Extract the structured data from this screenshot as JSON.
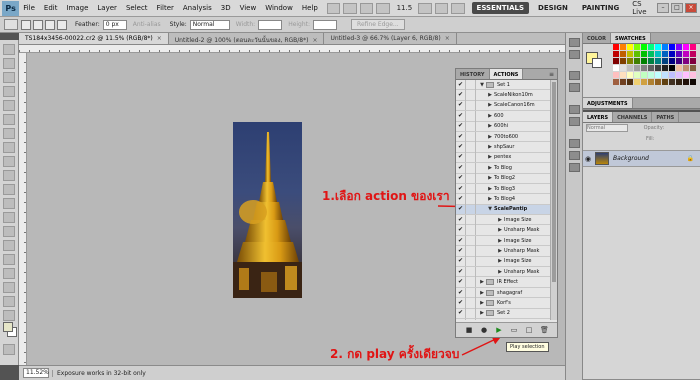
{
  "app": {
    "logo": "Ps",
    "menu": [
      "File",
      "Edit",
      "Image",
      "Layer",
      "Select",
      "Filter",
      "Analysis",
      "3D",
      "View",
      "Window",
      "Help"
    ],
    "zoom": "11.5",
    "workspaces": [
      "ESSENTIALS",
      "DESIGN",
      "PAINTING"
    ],
    "cs_live": "CS Live"
  },
  "options": {
    "feather_label": "Feather:",
    "feather_value": "0 px",
    "antialias_label": "Anti-alias",
    "style_label": "Style:",
    "style_value": "Normal",
    "width_label": "Width:",
    "height_label": "Height:",
    "refine_label": "Refine Edge..."
  },
  "tabs": [
    {
      "label": "TS184x3456-00022.cr2 @ 11.5% (RGB/8*)",
      "active": true
    },
    {
      "label": "Untitled-2 @ 100% (ตอนละวันนั้นของ, RGB/8*)",
      "active": false
    },
    {
      "label": "Untitled-3 @ 66.7% (Layer 6, RGB/8)",
      "active": false
    }
  ],
  "actions_panel": {
    "tabs": [
      "HISTORY",
      "ACTIONS"
    ],
    "active_tab": "ACTIONS",
    "rows": [
      {
        "name": "Set 1",
        "type": "set",
        "open": true
      },
      {
        "name": "ScaleNikon10m",
        "type": "action"
      },
      {
        "name": "ScaleCanon16m",
        "type": "action"
      },
      {
        "name": "600",
        "type": "action"
      },
      {
        "name": "600hi",
        "type": "action"
      },
      {
        "name": "700to600",
        "type": "action"
      },
      {
        "name": "shpSaur",
        "type": "action"
      },
      {
        "name": "pentex",
        "type": "action"
      },
      {
        "name": "To Blog",
        "type": "action"
      },
      {
        "name": "To Blog2",
        "type": "action"
      },
      {
        "name": "To Blog3",
        "type": "action"
      },
      {
        "name": "To Blog4",
        "type": "action"
      },
      {
        "name": "ScalePantip",
        "type": "action",
        "open": true,
        "selected": true
      },
      {
        "name": "Image Size",
        "type": "step"
      },
      {
        "name": "Unsharp Mask",
        "type": "step"
      },
      {
        "name": "Image Size",
        "type": "step"
      },
      {
        "name": "Unsharp Mask",
        "type": "step"
      },
      {
        "name": "Image Size",
        "type": "step"
      },
      {
        "name": "Unsharp Mask",
        "type": "step"
      },
      {
        "name": "IR Effect",
        "type": "set"
      },
      {
        "name": "shagagraf",
        "type": "set"
      },
      {
        "name": "Korf's",
        "type": "set"
      },
      {
        "name": "Set 2",
        "type": "set"
      },
      {
        "name": "Set 3",
        "type": "set"
      }
    ],
    "bottom_buttons": [
      "stop",
      "record",
      "play",
      "new-set",
      "new-action",
      "delete"
    ],
    "tooltip": "Play selection"
  },
  "annotations": {
    "step1": "1.เลือก action ของเรา",
    "step2": "2. กด play ครั้งเดียวจบ",
    "color": "#e01515"
  },
  "right_panels": {
    "color_tab": "COLOR",
    "swatches_tab": "SWATCHES",
    "adjustments_tab": "ADJUSTMENTS",
    "layers_tabs": [
      "LAYERS",
      "CHANNELS",
      "PATHS"
    ],
    "blend_mode": "Normal",
    "opacity_label": "Opacity:",
    "fill_label": "Fill:",
    "layer_name": "Background"
  },
  "status": {
    "zoom": "11.52%",
    "message": "Exposure works in 32-bit only"
  }
}
